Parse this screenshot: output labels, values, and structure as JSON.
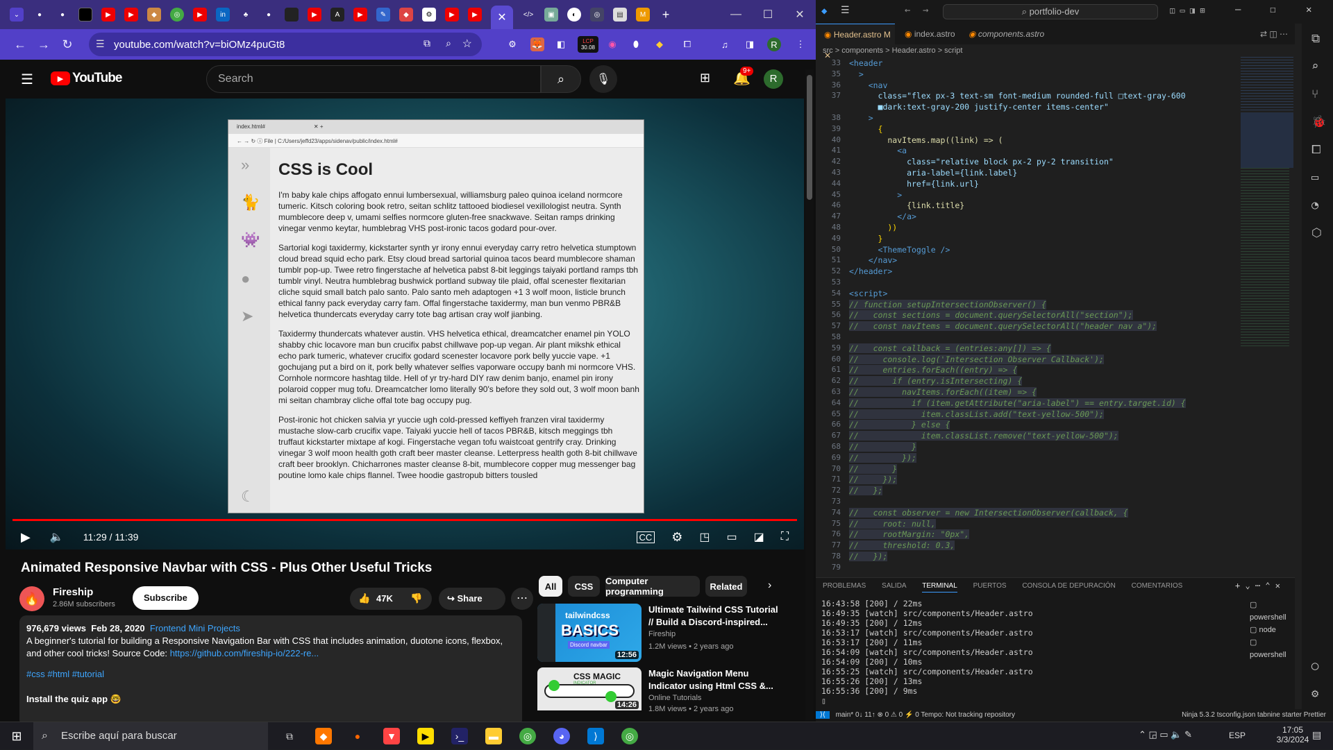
{
  "browser": {
    "address": "youtube.com/watch?v=biOMz4puGt8",
    "ext_badge": "30.08",
    "ext_badge_top": "LCP",
    "profile_initial": "R"
  },
  "youtube": {
    "logo_text": "YouTube",
    "search_placeholder": "Search",
    "notif_count": "9+",
    "avatar_initial": "R",
    "time": "11:29 / 11:39",
    "video_title": "Animated Responsive Navbar with CSS - Plus Other Useful Tricks",
    "channel": "Fireship",
    "subscribers": "2.86M subscribers",
    "subscribe_label": "Subscribe",
    "likes": "47K",
    "share_label": "Share",
    "views": "976,679 views",
    "date": "Feb 28, 2020",
    "playlist_link": "Frontend Mini Projects",
    "description": "A beginner's tutorial for building a Responsive Navigation Bar with CSS that includes animation, duotone icons, flexbox, and other cool tricks! Source Code:",
    "source_link": "https://github.com/fireship-io/222-re...",
    "hashtags": "#css #html #tutorial",
    "install_text": "Install the quiz app 🤓",
    "chips": [
      "All",
      "CSS",
      "Computer programming",
      "Related"
    ],
    "recs": [
      {
        "title": "Ultimate Tailwind CSS Tutorial // Build a Discord-inspired...",
        "channel": "Fireship",
        "meta": "1.2M views • 2 years ago",
        "duration": "12:56",
        "thumb_word": "BASICS",
        "thumb_top": "tailwindcss",
        "thumb_sub": "Discord navbar"
      },
      {
        "title": "Magic Navigation Menu Indicator using Html CSS &...",
        "channel": "Online Tutorials",
        "meta": "1.8M views • 2 years ago",
        "duration": "14:26",
        "thumb_word": "CSS MAGIC",
        "thumb_sub": "INDICATOR"
      }
    ]
  },
  "inner_page": {
    "tab_title": "index.html#",
    "address": "File  |  C:/Users/jeffd23/apps/sidenav/public/index.html#",
    "heading": "CSS is Cool",
    "paragraphs": [
      "I'm baby kale chips affogato ennui lumbersexual, williamsburg paleo quinoa iceland normcore tumeric. Kitsch coloring book retro, seitan schlitz tattooed biodiesel vexillologist neutra. Synth mumblecore deep v, umami selfies normcore gluten-free snackwave. Seitan ramps drinking vinegar venmo keytar, humblebrag VHS post-ironic tacos godard pour-over.",
      "Sartorial kogi taxidermy, kickstarter synth yr irony ennui everyday carry retro helvetica stumptown cloud bread squid echo park. Etsy cloud bread sartorial quinoa tacos beard mumblecore shaman tumblr pop-up. Twee retro fingerstache af helvetica pabst 8-bit leggings taiyaki portland ramps tbh tumblr vinyl. Neutra humblebrag bushwick portland subway tile plaid, offal scenester flexitarian cliche squid small batch palo santo. Palo santo meh adaptogen +1 3 wolf moon, listicle brunch ethical fanny pack everyday carry fam. Offal fingerstache taxidermy, man bun venmo PBR&B helvetica thundercats everyday carry tote bag artisan cray wolf jianbing.",
      "Taxidermy thundercats whatever austin. VHS helvetica ethical, dreamcatcher enamel pin YOLO shabby chic locavore man bun crucifix pabst chillwave pop-up vegan. Air plant mikshk ethical echo park tumeric, whatever crucifix godard scenester locavore pork belly yuccie vape. +1 gochujang put a bird on it, pork belly whatever selfies vaporware occupy banh mi normcore VHS. Cornhole normcore hashtag tilde. Hell of yr try-hard DIY raw denim banjo, enamel pin irony polaroid copper mug tofu. Dreamcatcher lomo literally 90's before they sold out, 3 wolf moon banh mi seitan chambray cliche offal tote bag occupy pug.",
      "Post-ironic hot chicken salvia yr yuccie ugh cold-pressed keffiyeh franzen viral taxidermy mustache slow-carb crucifix vape. Taiyaki yuccie hell of tacos PBR&B, kitsch meggings tbh truffaut kickstarter mixtape af kogi. Fingerstache vegan tofu waistcoat gentrify cray. Drinking vinegar 3 wolf moon health goth craft beer master cleanse. Letterpress health goth 8-bit chillwave craft beer brooklyn. Chicharrones master cleanse 8-bit, mumblecore copper mug messenger bag poutine lomo kale chips flannel. Twee hoodie gastropub bitters tousled"
    ]
  },
  "vscode": {
    "search": "portfolio-dev",
    "tabs": [
      "Header.astro M",
      "index.astro",
      "components.astro"
    ],
    "breadcrumb": "src > components > Header.astro > script",
    "code_lines": [
      {
        "n": "33",
        "t": "<header"
      },
      {
        "n": "35",
        "t": "  >"
      },
      {
        "n": "36",
        "t": "    <nav"
      },
      {
        "n": "37",
        "t": "      class=\"flex px-3 text-sm font-medium rounded-full □text-gray-600"
      },
      {
        "n": "",
        "t": "      ■dark:text-gray-200 justify-center items-center\""
      },
      {
        "n": "38",
        "t": "    >"
      },
      {
        "n": "39",
        "t": "      {"
      },
      {
        "n": "40",
        "t": "        navItems.map((link) => ("
      },
      {
        "n": "41",
        "t": "          <a"
      },
      {
        "n": "42",
        "t": "            class=\"relative block px-2 py-2 transition\""
      },
      {
        "n": "43",
        "t": "            aria-label={link.label}"
      },
      {
        "n": "44",
        "t": "            href={link.url}"
      },
      {
        "n": "45",
        "t": "          >"
      },
      {
        "n": "46",
        "t": "            {link.title}"
      },
      {
        "n": "47",
        "t": "          </a>"
      },
      {
        "n": "48",
        "t": "        ))"
      },
      {
        "n": "49",
        "t": "      }"
      },
      {
        "n": "50",
        "t": "      <ThemeToggle />"
      },
      {
        "n": "51",
        "t": "    </nav>"
      },
      {
        "n": "52",
        "t": "</header>"
      },
      {
        "n": "53",
        "t": ""
      },
      {
        "n": "54",
        "t": "<script>"
      },
      {
        "n": "55",
        "t": "// function setupIntersectionObserver() {"
      },
      {
        "n": "56",
        "t": "//   const sections = document.querySelectorAll(\"section\");"
      },
      {
        "n": "57",
        "t": "//   const navItems = document.querySelectorAll(\"header nav a\");"
      },
      {
        "n": "58",
        "t": ""
      },
      {
        "n": "59",
        "t": "//   const callback = (entries:any[]) => {"
      },
      {
        "n": "60",
        "t": "//     console.log('Intersection Observer Callback');"
      },
      {
        "n": "61",
        "t": "//     entries.forEach((entry) => {"
      },
      {
        "n": "62",
        "t": "//       if (entry.isIntersecting) {"
      },
      {
        "n": "63",
        "t": "//         navItems.forEach((item) => {"
      },
      {
        "n": "64",
        "t": "//           if (item.getAttribute(\"aria-label\") == entry.target.id) {"
      },
      {
        "n": "65",
        "t": "//             item.classList.add(\"text-yellow-500\");"
      },
      {
        "n": "66",
        "t": "//           } else {"
      },
      {
        "n": "67",
        "t": "//             item.classList.remove(\"text-yellow-500\");"
      },
      {
        "n": "68",
        "t": "//           }"
      },
      {
        "n": "69",
        "t": "//         });"
      },
      {
        "n": "70",
        "t": "//       }"
      },
      {
        "n": "71",
        "t": "//     });"
      },
      {
        "n": "72",
        "t": "//   };"
      },
      {
        "n": "73",
        "t": ""
      },
      {
        "n": "74",
        "t": "//   const observer = new IntersectionObserver(callback, {"
      },
      {
        "n": "75",
        "t": "//     root: null,"
      },
      {
        "n": "76",
        "t": "//     rootMargin: \"0px\","
      },
      {
        "n": "77",
        "t": "//     threshold: 0.3,"
      },
      {
        "n": "78",
        "t": "//   });"
      },
      {
        "n": "79",
        "t": ""
      }
    ],
    "panel_tabs": [
      "PROBLEMAS",
      "SALIDA",
      "TERMINAL",
      "PUERTOS",
      "CONSOLA DE DEPURACIÓN",
      "COMENTARIOS"
    ],
    "terminal_lines": [
      "16:43:58 [200] / 22ms",
      "16:49:35 [watch] src/components/Header.astro",
      "16:49:35 [200] / 12ms",
      "16:53:17 [watch] src/components/Header.astro",
      "16:53:17 [200] / 11ms",
      "16:54:09 [watch] src/components/Header.astro",
      "16:54:09 [200] / 10ms",
      "16:55:25 [watch] src/components/Header.astro",
      "16:55:26 [200] / 13ms",
      "16:55:36 [200] / 9ms"
    ],
    "term_list": [
      "powershell",
      "node",
      "powershell"
    ],
    "status_left": "main*   0↓ 11↑   ⊗ 0 ⚠ 0   ⚡ 0   Tempo: Not tracking repository",
    "status_right": "Ninja   5.3.2   tsconfig.json   tabnine starter   Prettier"
  },
  "taskbar": {
    "search": "Escribe aquí para buscar",
    "lang": "ESP",
    "time": "17:05",
    "date": "3/3/2024"
  }
}
